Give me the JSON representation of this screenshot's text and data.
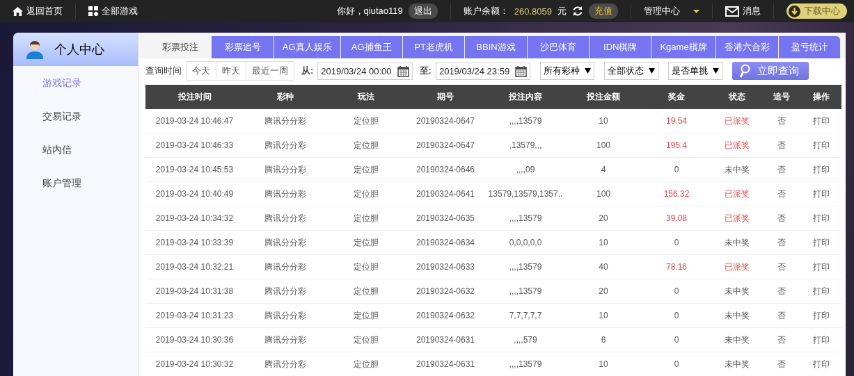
{
  "topbar": {
    "home": "返回首页",
    "all_games": "全部游戏",
    "greeting": "你好，qiutao119",
    "logout": "退出",
    "balance_label": "账户余额：",
    "balance": "260.8059",
    "currency": "元",
    "recharge": "充值",
    "manage": "管理中心",
    "messages": "消息",
    "download": "下载中心"
  },
  "sidebar": {
    "title": "个人中心",
    "items": [
      {
        "label": "游戏记录",
        "selected": true
      },
      {
        "label": "交易记录",
        "selected": false
      },
      {
        "label": "站内信",
        "selected": false
      },
      {
        "label": "账户管理",
        "selected": false
      }
    ]
  },
  "tabs": [
    {
      "label": "彩票投注",
      "selected": true
    },
    {
      "label": "彩票追号",
      "selected": false
    },
    {
      "label": "AG真人娱乐",
      "selected": false
    },
    {
      "label": "AG捕鱼王",
      "selected": false
    },
    {
      "label": "PT老虎机",
      "selected": false
    },
    {
      "label": "BBIN游戏",
      "selected": false
    },
    {
      "label": "沙巴体育",
      "selected": false
    },
    {
      "label": "IDN棋牌",
      "selected": false
    },
    {
      "label": "Kgame棋牌",
      "selected": false
    },
    {
      "label": "香港六合彩",
      "selected": false
    },
    {
      "label": "盈亏统计",
      "selected": false
    }
  ],
  "filters": {
    "time_label": "查询时间",
    "quick": [
      {
        "label": "今天"
      },
      {
        "label": "昨天"
      },
      {
        "label": "最近一周"
      }
    ],
    "from_label": "从:",
    "from": "2019/03/24 00:00",
    "to_label": "至:",
    "to": "2019/03/24 23:59",
    "selects": [
      "所有彩种",
      "全部状态",
      "是否单挑"
    ],
    "search": "立即查询"
  },
  "table": {
    "columns": [
      "投注时间",
      "彩种",
      "玩法",
      "期号",
      "投注内容",
      "投注金额",
      "奖金",
      "状态",
      "追号",
      "操作"
    ],
    "rows": [
      {
        "cells": [
          "2019-03-24 10:46:47",
          "腾讯分分彩",
          "定位胆",
          "20190324-0647",
          ",,,,13579",
          "10",
          "19.54",
          "已派奖",
          "否",
          "打印"
        ],
        "won": true
      },
      {
        "cells": [
          "2019-03-24 10:46:33",
          "腾讯分分彩",
          "定位胆",
          "20190324-0647",
          ",13579,,,",
          "100",
          "195.4",
          "已派奖",
          "否",
          "打印"
        ],
        "won": true
      },
      {
        "cells": [
          "2019-03-24 10:45:53",
          "腾讯分分彩",
          "定位胆",
          "20190324-0646",
          ",,,,09",
          "4",
          "0",
          "未中奖",
          "否",
          "打印"
        ],
        "won": false
      },
      {
        "cells": [
          "2019-03-24 10:40:49",
          "腾讯分分彩",
          "定位胆",
          "20190324-0641",
          "13579,13579,1357..",
          "100",
          "156.32",
          "已派奖",
          "否",
          "打印"
        ],
        "won": true
      },
      {
        "cells": [
          "2019-03-24 10:34:32",
          "腾讯分分彩",
          "定位胆",
          "20190324-0635",
          ",,,,13579",
          "20",
          "39.08",
          "已派奖",
          "否",
          "打印"
        ],
        "won": true
      },
      {
        "cells": [
          "2019-03-24 10:33:39",
          "腾讯分分彩",
          "定位胆",
          "20190324-0634",
          "0,0,0,0,0",
          "10",
          "0",
          "未中奖",
          "否",
          "打印"
        ],
        "won": false
      },
      {
        "cells": [
          "2019-03-24 10:32:21",
          "腾讯分分彩",
          "定位胆",
          "20190324-0633",
          ",,,,13579",
          "40",
          "78.16",
          "已派奖",
          "否",
          "打印"
        ],
        "won": true
      },
      {
        "cells": [
          "2019-03-24 10:31:38",
          "腾讯分分彩",
          "定位胆",
          "20190324-0632",
          ",,,,13579",
          "20",
          "0",
          "未中奖",
          "否",
          "打印"
        ],
        "won": false
      },
      {
        "cells": [
          "2019-03-24 10:31:23",
          "腾讯分分彩",
          "定位胆",
          "20190324-0632",
          "7,7,7,7,7",
          "10",
          "0",
          "未中奖",
          "否",
          "打印"
        ],
        "won": false
      },
      {
        "cells": [
          "2019-03-24 10:30:36",
          "腾讯分分彩",
          "定位胆",
          "20190324-0631",
          ",,,,579",
          "6",
          "0",
          "未中奖",
          "否",
          "打印"
        ],
        "won": false
      },
      {
        "cells": [
          "2019-03-24 10:30:32",
          "腾讯分分彩",
          "定位胆",
          "20190324-0631",
          ",,,,13579",
          "10",
          "0",
          "未中奖",
          "否",
          "打印"
        ],
        "won": false
      }
    ]
  }
}
